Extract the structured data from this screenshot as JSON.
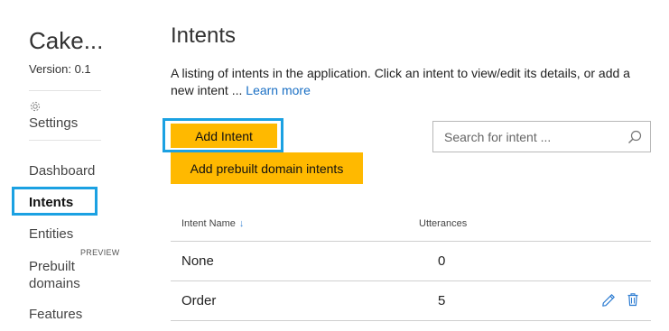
{
  "sidebar": {
    "app_name": "Cake...",
    "version": "Version:  0.1",
    "settings_label": "Settings",
    "nav": [
      {
        "label": "Dashboard"
      },
      {
        "label": "Intents",
        "active": true
      },
      {
        "label": "Entities"
      },
      {
        "label": "Prebuilt\ndomains",
        "tag": "PREVIEW"
      },
      {
        "label": "Features"
      }
    ]
  },
  "main": {
    "title": "Intents",
    "description": "A listing of intents in the application. Click an intent to view/edit its details, or add a new intent ...",
    "learn_more": "Learn more",
    "add_intent_label": "Add Intent",
    "add_prebuilt_label": "Add prebuilt domain intents",
    "search": {
      "placeholder": "Search for intent ...",
      "value": ""
    }
  },
  "table": {
    "columns": {
      "name": "Intent Name",
      "utterances": "Utterances"
    },
    "rows": [
      {
        "name": "None",
        "utterances": "0"
      },
      {
        "name": "Order",
        "utterances": "5",
        "actions": [
          "edit-icon",
          "delete-icon"
        ]
      }
    ]
  },
  "colors": {
    "accent_button": "#ffb900",
    "highlight_box": "#1ba1e2",
    "link": "#1a6fc4",
    "icon_blue": "#2b7bd1"
  }
}
